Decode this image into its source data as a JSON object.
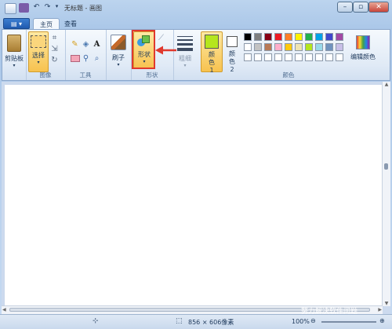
{
  "window": {
    "title": "无标题 - 画图",
    "controls": {
      "minimize": "–",
      "maximize": "▫",
      "close": "✕"
    }
  },
  "menu": {
    "app_button": "▤ ▾",
    "tabs": [
      {
        "label": "主页",
        "active": true
      },
      {
        "label": "查看",
        "active": false
      }
    ]
  },
  "ribbon": {
    "clipboard": {
      "button": "剪贴板",
      "arrow": "▾"
    },
    "image": {
      "select": "选择",
      "arrow": "▾",
      "group_label": "图像"
    },
    "tools": {
      "group_label": "工具"
    },
    "brushes": {
      "label": "刷子",
      "arrow": "▾"
    },
    "shapes": {
      "label": "形状",
      "arrow": "▾",
      "group_label": "形状"
    },
    "size": {
      "label": "粗细",
      "arrow": "▾"
    },
    "color1": {
      "label": "颜色 1",
      "color": "#b5e61d"
    },
    "color2": {
      "label": "颜色 2",
      "color": "#ffffff"
    },
    "edit_colors": {
      "label": "编辑颜色"
    },
    "colors_group_label": "颜色",
    "palette_row1": [
      "#000000",
      "#7f7f7f",
      "#880015",
      "#ed1c24",
      "#ff7f27",
      "#fff200",
      "#22b14c",
      "#00a2e8",
      "#3f48cc",
      "#a349a4"
    ],
    "palette_row2": [
      "#ffffff",
      "#c3c3c3",
      "#b97a57",
      "#ffaec9",
      "#ffc90e",
      "#efe4b0",
      "#b5e61d",
      "#99d9ea",
      "#7092be",
      "#c8bfe7"
    ],
    "highlight_color": "#e0392e"
  },
  "status": {
    "canvas_size": "856 × 606像素",
    "zoom": "100%"
  },
  "watermark": {
    "brand": "软件无忧",
    "tagline": "努力解决软件问题"
  }
}
